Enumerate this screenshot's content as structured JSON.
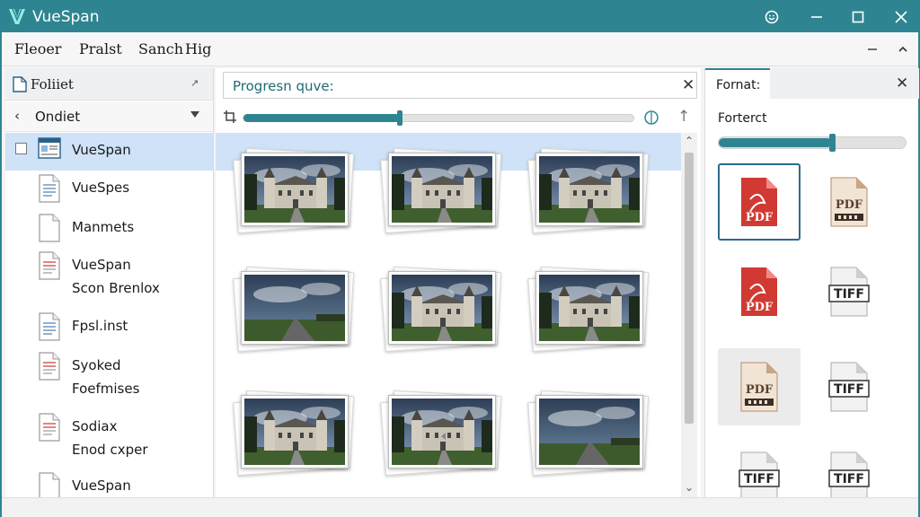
{
  "app": {
    "title": "VueSpan",
    "accent": "#2e8591"
  },
  "menu": {
    "items": [
      "Fleoer",
      "Pralst",
      "Sanch",
      "Hig"
    ]
  },
  "left_pane": {
    "header_label": "Foliiet",
    "sub_label": "Ondiet",
    "items": [
      {
        "line1": "VueSpan",
        "line2": "",
        "icon": "window-doc-icon",
        "selected": true
      },
      {
        "line1": "VueSpes",
        "line2": "",
        "icon": "document-icon",
        "selected": false
      },
      {
        "line1": "Manmets",
        "line2": "",
        "icon": "blank-document-icon",
        "selected": false
      },
      {
        "line1": "VueSpan",
        "line2": "Scon Brenlox",
        "icon": "red-document-icon",
        "selected": false
      },
      {
        "line1": "Fpsl.inst",
        "line2": "",
        "icon": "document-icon",
        "selected": false
      },
      {
        "line1": "Syoked",
        "line2": "Foefmises",
        "icon": "red-document-icon",
        "selected": false
      },
      {
        "line1": "Sodiax",
        "line2": "Enod cxper",
        "icon": "red-document-icon",
        "selected": false
      },
      {
        "line1": "VueSpan",
        "line2": "",
        "icon": "blank-document-icon",
        "selected": false
      }
    ]
  },
  "middle_pane": {
    "search_value": "Progresn quve:",
    "progress_fraction": 0.4,
    "thumbnails": [
      {
        "scene": "castle-road"
      },
      {
        "scene": "castle-front"
      },
      {
        "scene": "mansion"
      },
      {
        "scene": "road-clouds"
      },
      {
        "scene": "castle-front"
      },
      {
        "scene": "mansion-side"
      },
      {
        "scene": "castle-bottom"
      },
      {
        "scene": "castle-bottom"
      },
      {
        "scene": "road-bottom"
      }
    ]
  },
  "right_pane": {
    "tab_label": "Fornat:",
    "slider_label": "Forterct",
    "slider_fraction": 0.6,
    "formats": [
      {
        "text": "PDF",
        "style": "red",
        "selected": true
      },
      {
        "text": "PDF",
        "style": "brown",
        "selected": false
      },
      {
        "text": "PDF",
        "style": "red",
        "selected": false
      },
      {
        "text": "TIFF",
        "style": "gray",
        "selected": false
      },
      {
        "text": "PDF",
        "style": "brown",
        "selected": false,
        "hover": true
      },
      {
        "text": "TIFF",
        "style": "gray",
        "selected": false
      },
      {
        "text": "TIFF",
        "style": "gray",
        "selected": false
      },
      {
        "text": "TIFF",
        "style": "gray",
        "selected": false
      }
    ]
  }
}
